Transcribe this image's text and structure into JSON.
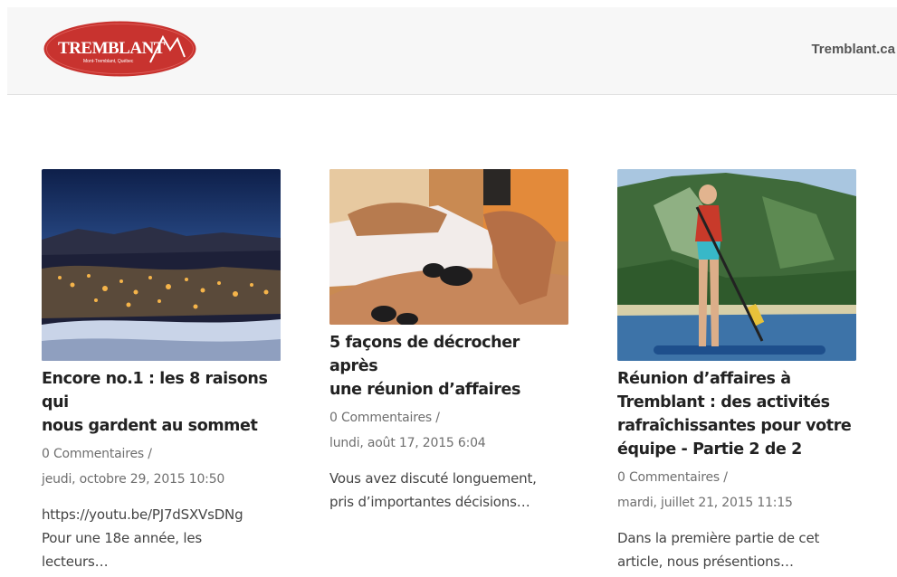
{
  "header": {
    "logo_text": "TREMBLANT",
    "logo_subtext": "Mont-Tremblant, Québec",
    "site_link": "Tremblant.ca",
    "logo_color": "#c8332f"
  },
  "posts": [
    {
      "title_line1": "Encore no.1 : les 8 raisons qui",
      "title_line2": "nous gardent au sommet",
      "comments": "0 Commentaires /",
      "date": "jeudi, octobre 29, 2015 10:50",
      "excerpt_line1": "https://youtu.be/PJ7dSXVsDNg",
      "excerpt_line2": "Pour une 18e année, les",
      "excerpt_line3": "lecteurs…"
    },
    {
      "title_line1": "5 façons de décrocher après",
      "title_line2": "une réunion d’affaires",
      "comments": "0 Commentaires /",
      "date": "lundi, août 17, 2015 6:04",
      "excerpt_line1": "Vous avez discuté longuement,",
      "excerpt_line2": "pris d’importantes décisions…"
    },
    {
      "title_line1": "Réunion d’affaires à",
      "title_line2": "Tremblant : des activités",
      "title_line3": "rafraîchissantes pour votre",
      "title_line4": "équipe - Partie 2 de 2",
      "comments": "0 Commentaires /",
      "date": "mardi, juillet 21, 2015 11:15",
      "excerpt_line1": "Dans la première partie de cet",
      "excerpt_line2": "article, nous présentions…"
    }
  ]
}
